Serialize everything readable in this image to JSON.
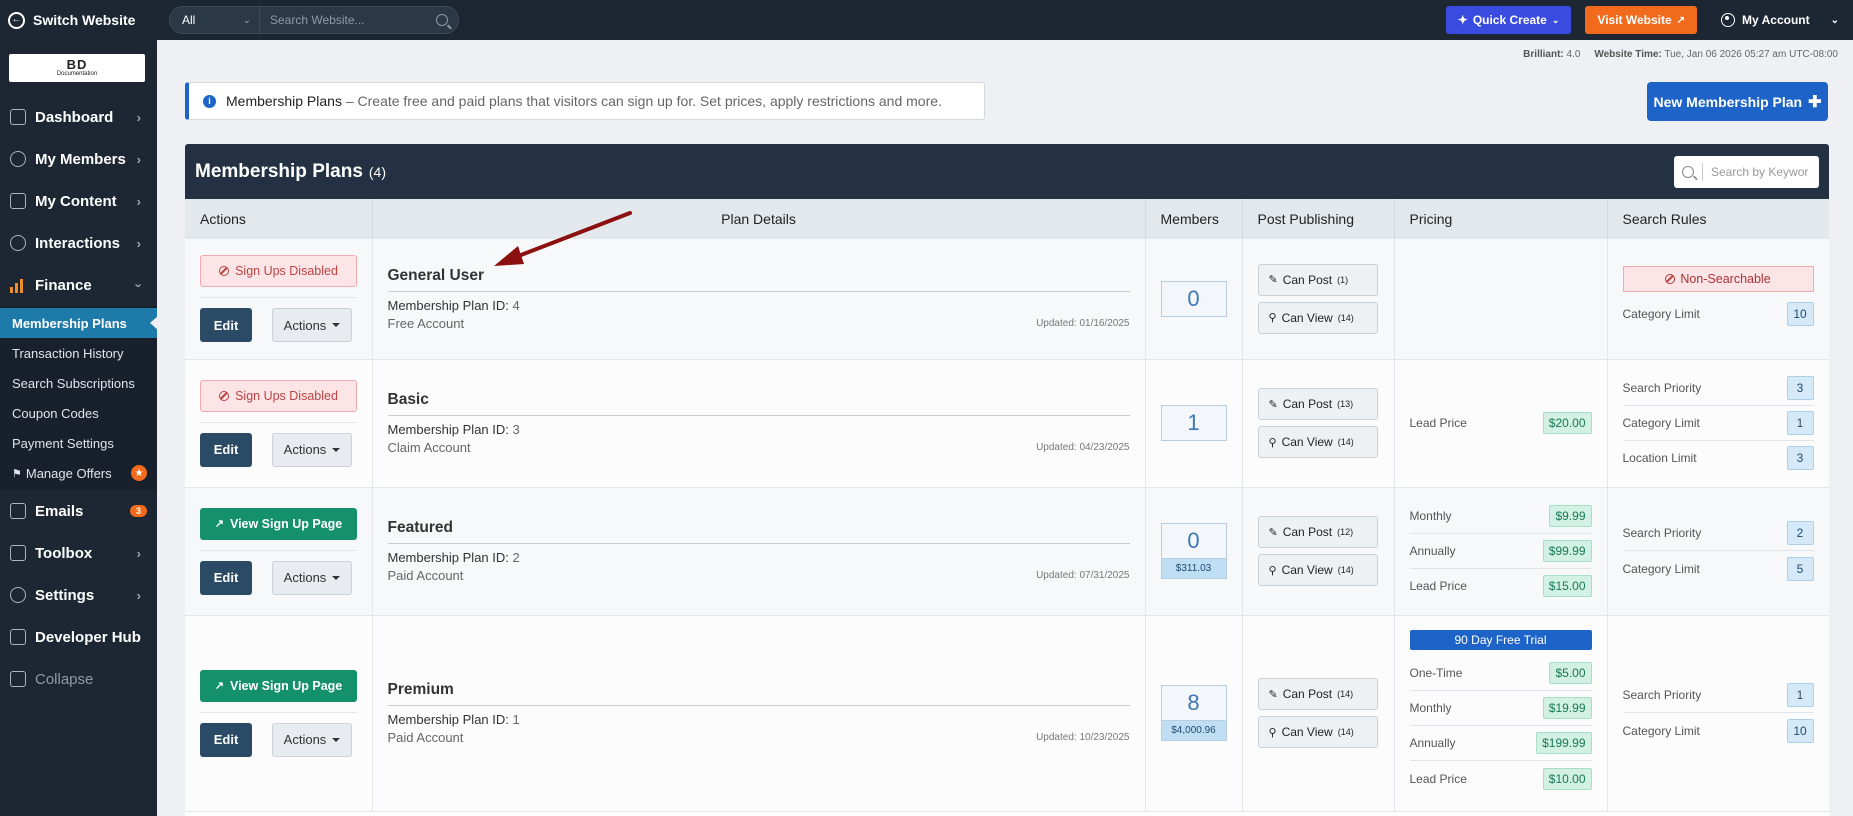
{
  "topbar": {
    "switch_label": "Switch Website",
    "search_scope": "All",
    "search_placeholder": "Search Website...",
    "quick_create": "Quick Create",
    "visit_website": "Visit Website",
    "account": "My Account"
  },
  "sidebar": {
    "logo_main": "BD",
    "logo_sub": "Documentation",
    "items": [
      {
        "label": "Dashboard"
      },
      {
        "label": "My Members"
      },
      {
        "label": "My Content"
      },
      {
        "label": "Interactions"
      },
      {
        "label": "Finance"
      }
    ],
    "finance_sub": [
      {
        "label": "Membership Plans"
      },
      {
        "label": "Transaction History"
      },
      {
        "label": "Search Subscriptions"
      },
      {
        "label": "Coupon Codes"
      },
      {
        "label": "Payment Settings"
      },
      {
        "label": "Manage Offers"
      }
    ],
    "bottom": [
      {
        "label": "Emails",
        "badge": "3"
      },
      {
        "label": "Toolbox"
      },
      {
        "label": "Settings"
      },
      {
        "label": "Developer Hub"
      },
      {
        "label": "Collapse"
      }
    ]
  },
  "status": {
    "brilliant_label": "Brilliant:",
    "brilliant_value": "4.0",
    "time_label": "Website Time:",
    "time_value": "Tue, Jan 06 2026 05:27 am UTC-08:00"
  },
  "info": {
    "title": "Membership Plans",
    "desc": "– Create free and paid plans that visitors can sign up for. Set prices, apply restrictions and more."
  },
  "new_plan_button": "New Membership Plan",
  "panel": {
    "title": "Membership Plans",
    "count": "(4)",
    "search_placeholder": "Search by Keywor"
  },
  "columns": [
    "Actions",
    "Plan Details",
    "Members",
    "Post Publishing",
    "Pricing",
    "Search Rules"
  ],
  "labels": {
    "signups_disabled": "Sign Ups Disabled",
    "view_signup": "View Sign Up Page",
    "edit": "Edit",
    "actions": "Actions",
    "plan_id": "Membership Plan ID:",
    "can_post": "Can Post",
    "can_view": "Can View",
    "non_searchable": "Non-Searchable"
  },
  "plans": [
    {
      "name": "General User",
      "id": "4",
      "type": "Free Account",
      "updated": "Updated: 01/16/2025",
      "members": "0",
      "amount": "",
      "can_post": "(1)",
      "can_view": "(14)",
      "pricing": [],
      "search": [
        {
          "label": "Category Limit",
          "value": "10"
        }
      ]
    },
    {
      "name": "Basic",
      "id": "3",
      "type": "Claim Account",
      "updated": "Updated: 04/23/2025",
      "members": "1",
      "amount": "",
      "can_post": "(13)",
      "can_view": "(14)",
      "pricing": [
        {
          "label": "Lead Price",
          "value": "$20.00"
        }
      ],
      "search": [
        {
          "label": "Search Priority",
          "value": "3"
        },
        {
          "label": "Category Limit",
          "value": "1"
        },
        {
          "label": "Location Limit",
          "value": "3"
        }
      ]
    },
    {
      "name": "Featured",
      "id": "2",
      "type": "Paid Account",
      "updated": "Updated: 07/31/2025",
      "members": "0",
      "amount": "$311.03",
      "can_post": "(12)",
      "can_view": "(14)",
      "pricing": [
        {
          "label": "Monthly",
          "value": "$9.99"
        },
        {
          "label": "Annually",
          "value": "$99.99"
        },
        {
          "label": "Lead Price",
          "value": "$15.00"
        }
      ],
      "search": [
        {
          "label": "Search Priority",
          "value": "2"
        },
        {
          "label": "Category Limit",
          "value": "5"
        }
      ]
    },
    {
      "name": "Premium",
      "id": "1",
      "type": "Paid Account",
      "updated": "Updated: 10/23/2025",
      "members": "8",
      "amount": "$4,000.96",
      "can_post": "(14)",
      "can_view": "(14)",
      "trial": "90 Day Free Trial",
      "pricing": [
        {
          "label": "One-Time",
          "value": "$5.00"
        },
        {
          "label": "Monthly",
          "value": "$19.99"
        },
        {
          "label": "Annually",
          "value": "$199.99"
        },
        {
          "label": "Lead Price",
          "value": "$10.00"
        }
      ],
      "search": [
        {
          "label": "Search Priority",
          "value": "1"
        },
        {
          "label": "Category Limit",
          "value": "10"
        }
      ]
    }
  ]
}
